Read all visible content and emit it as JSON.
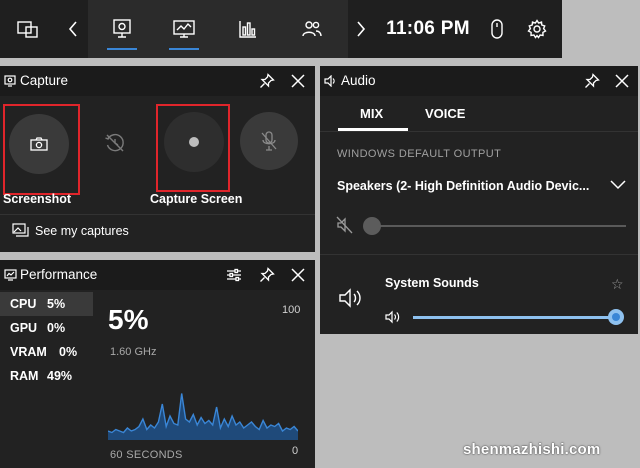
{
  "topbar": {
    "clock": "11:06 PM",
    "icons": [
      "widget-menu-icon",
      "chevron-left-icon",
      "capture-widget-icon",
      "performance-widget-icon",
      "resources-chart-icon",
      "social-icon",
      "chevron-right-icon",
      "mouse-icon",
      "settings-gear-icon"
    ],
    "accent_color": "#3a86d6"
  },
  "capture": {
    "title": "Capture",
    "screenshot_label": "Screenshot",
    "capture_screen_label": "Capture Screen",
    "see_captures_label": "See my captures",
    "highlight_color": "#e0252b"
  },
  "performance": {
    "title": "Performance",
    "metrics": [
      {
        "name": "CPU",
        "value": "5%"
      },
      {
        "name": "GPU",
        "value": "0%"
      },
      {
        "name": "VRAM",
        "value": "0%"
      },
      {
        "name": "RAM",
        "value": "49%"
      }
    ],
    "selected_value": "5%",
    "clock_speed": "1.60 GHz",
    "graph_max": "100",
    "graph_min": "0",
    "time_span": "60 SECONDS",
    "graph_color": "#3a86d6",
    "usage_samples": [
      6,
      5,
      7,
      6,
      5,
      8,
      6,
      7,
      9,
      14,
      7,
      10,
      8,
      12,
      24,
      9,
      16,
      11,
      10,
      31,
      14,
      12,
      17,
      10,
      15,
      11,
      13,
      10,
      22,
      8,
      14,
      9,
      16,
      10,
      12,
      8,
      10,
      12,
      9,
      7,
      13,
      8,
      10,
      9,
      11,
      6,
      8,
      7,
      9,
      6
    ]
  },
  "audio": {
    "title": "Audio",
    "tabs": [
      "MIX",
      "VOICE"
    ],
    "active_tab": "MIX",
    "section_label": "WINDOWS DEFAULT OUTPUT",
    "device_name": "Speakers (2- High Definition Audio Devic...",
    "master_volume_pct": 0,
    "apps": [
      {
        "name": "System Sounds",
        "volume_pct": 100
      }
    ],
    "slider_color": "#8ec1ef"
  },
  "watermark": "shenmazhishi.com"
}
